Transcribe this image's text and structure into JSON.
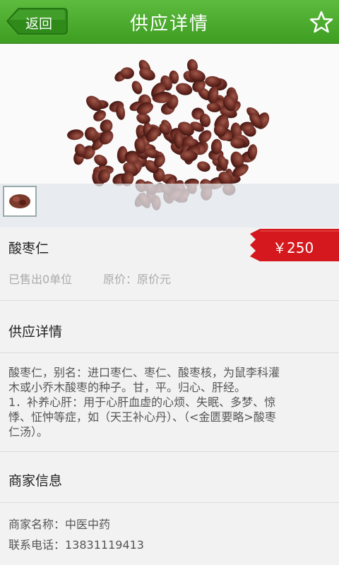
{
  "header": {
    "back_label": "返回",
    "title": "供应详情",
    "favorite_icon": "star-outline-icon",
    "bg_color": "#4aab2e"
  },
  "product": {
    "image": "jujube-seeds-photo",
    "thumbnail": "jujube-seeds-thumbnail",
    "name": "酸枣仁",
    "price": "￥250",
    "sold": "已售出0单位",
    "original_price": "原价：原价元",
    "price_tag_color": "#d4181d"
  },
  "supply": {
    "title": "供应详情",
    "description_lines": [
      "酸枣仁，别名：进口枣仁、枣仁、酸枣核，为鼠李科灌",
      "木或小乔木酸枣的种子。甘，平。归心、肝经。",
      "1．补养心肝：用于心肝血虚的心烦、失眠、多梦、惊",
      "悸、怔忡等症，如（天王补心丹）、（<金匮要略>酸枣",
      "仁汤）。"
    ]
  },
  "merchant": {
    "title": "商家信息",
    "name_line": "商家名称：中医中药",
    "phone_line": "联系电话：13831119413"
  }
}
